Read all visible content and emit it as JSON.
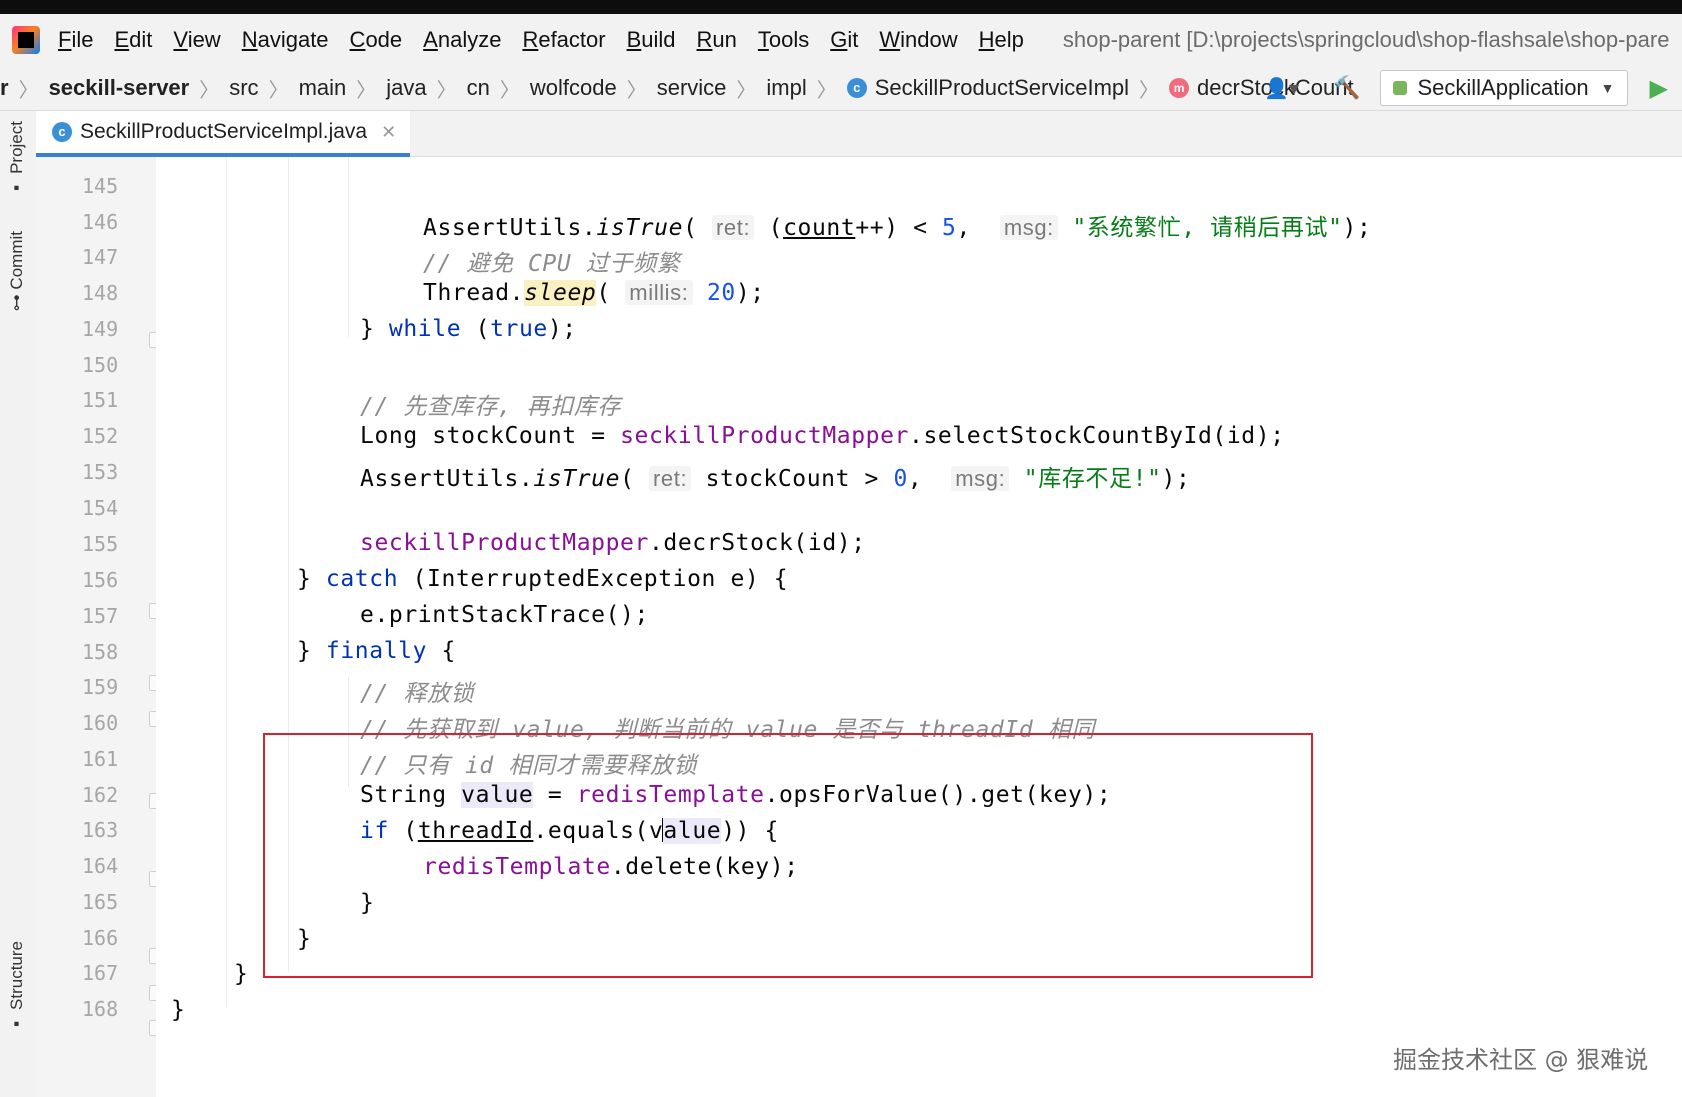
{
  "menu": {
    "items": [
      "File",
      "Edit",
      "View",
      "Navigate",
      "Code",
      "Analyze",
      "Refactor",
      "Build",
      "Run",
      "Tools",
      "Git",
      "Window",
      "Help"
    ],
    "project_path": "shop-parent [D:\\projects\\springcloud\\shop-flashsale\\shop-pare"
  },
  "breadcrumb": {
    "lead": "r",
    "items": [
      "seckill-server",
      "src",
      "main",
      "java",
      "cn",
      "wolfcode",
      "service",
      "impl"
    ],
    "class_name": "SeckillProductServiceImpl",
    "method_name": "decrStockCount"
  },
  "toolbar": {
    "run_config": "SeckillApplication"
  },
  "side_tabs": {
    "project": "Project",
    "commit": "Commit",
    "structure": "Structure"
  },
  "editor": {
    "tab_title": "SeckillProductServiceImpl.java",
    "line_numbers": [
      "145",
      "146",
      "147",
      "148",
      "149",
      "150",
      "151",
      "152",
      "153",
      "154",
      "155",
      "156",
      "157",
      "158",
      "159",
      "160",
      "161",
      "162",
      "163",
      "164",
      "165",
      "166",
      "167",
      "168"
    ],
    "code": {
      "l146_a": "AssertUtils.",
      "l146_method": "isTrue",
      "l146_b": "(",
      "l146_hint_ret": "ret:",
      "l146_c": "(",
      "l146_var": "count",
      "l146_d": "++) < ",
      "l146_num": "5",
      "l146_e": ",",
      "l146_hint_msg": "msg:",
      "l146_str": "\"系统繁忙, 请稍后再试\"",
      "l146_f": ");",
      "l147_cmt": "// 避免 CPU 过于频繁",
      "l148_a": "Thread.",
      "l148_method": "sleep",
      "l148_b": "(",
      "l148_hint": "millis:",
      "l148_num": "20",
      "l148_c": ");",
      "l149_a": "} ",
      "l149_kw": "while",
      "l149_b": " (",
      "l149_kw2": "true",
      "l149_c": ");",
      "l151_cmt": "// 先查库存, 再扣库存",
      "l152_a": "Long stockCount = ",
      "l152_field": "seckillProductMapper",
      "l152_b": ".selectStockCountById(id);",
      "l153_a": "AssertUtils.",
      "l153_method": "isTrue",
      "l153_b": "(",
      "l153_hint_ret": "ret:",
      "l153_c": "stockCount > ",
      "l153_num": "0",
      "l153_d": ",",
      "l153_hint_msg": "msg:",
      "l153_str": "\"库存不足!\"",
      "l153_e": ");",
      "l155_field": "seckillProductMapper",
      "l155_b": ".decrStock(id);",
      "l156_a": "} ",
      "l156_kw": "catch",
      "l156_b": " (InterruptedException e) {",
      "l157_a": "e.printStackTrace();",
      "l158_a": "} ",
      "l158_kw": "finally",
      "l158_b": " {",
      "l159_cmt": "// 释放锁",
      "l160_cmt": "// 先获取到 value, 判断当前的 value 是否与 threadId 相同",
      "l161_cmt": "// 只有 id 相同才需要释放锁",
      "l162_a": "String ",
      "l162_var": "value",
      "l162_b": " = ",
      "l162_field": "redisTemplate",
      "l162_c": ".opsForValue().get(key);",
      "l163_kw": "if",
      "l163_a": " (",
      "l163_var": "threadId",
      "l163_b": ".equals(v",
      "l163_var2": "alue",
      "l163_c": ")) {",
      "l164_field": "redisTemplate",
      "l164_b": ".delete(key);",
      "l165_a": "}",
      "l166_a": "}",
      "l167_a": "}",
      "l168_a": "}"
    }
  },
  "watermark": "掘金技术社区 @ 狠难说"
}
